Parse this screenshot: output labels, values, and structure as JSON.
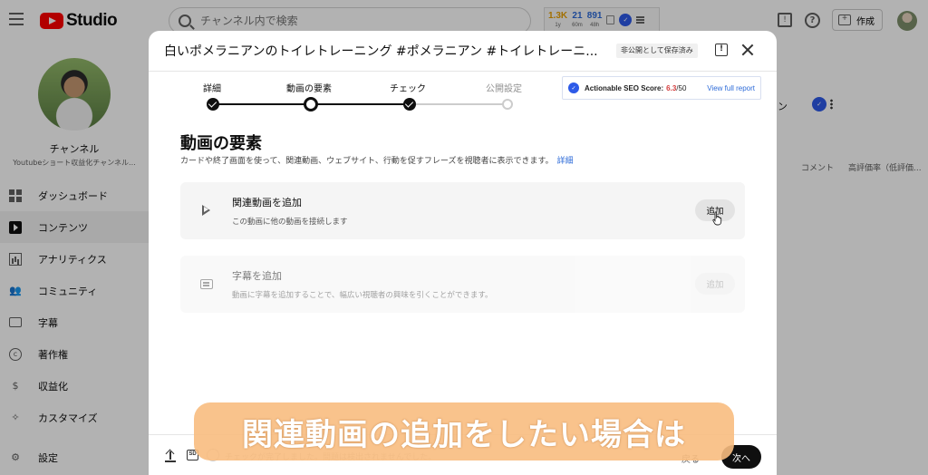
{
  "app": {
    "logo_text": "Studio"
  },
  "search": {
    "placeholder": "チャンネル内で検索"
  },
  "stats_bar": {
    "items": [
      {
        "value": "1.3K",
        "sub": "1y"
      },
      {
        "value": "21",
        "sub": "60m"
      },
      {
        "value": "891",
        "sub": "48h"
      }
    ]
  },
  "header": {
    "create_label": "作成"
  },
  "sidebar": {
    "channel_label": "チャンネル",
    "channel_name": "Youtubeショート収益化チャンネル...",
    "items": [
      {
        "label": "ダッシュボード",
        "icon": "dashboard-icon"
      },
      {
        "label": "コンテンツ",
        "icon": "content-icon",
        "active": true
      },
      {
        "label": "アナリティクス",
        "icon": "analytics-icon"
      },
      {
        "label": "コミュニティ",
        "icon": "community-icon"
      },
      {
        "label": "字幕",
        "icon": "subtitles-icon"
      },
      {
        "label": "著作権",
        "icon": "copyright-icon"
      },
      {
        "label": "収益化",
        "icon": "monetization-icon"
      },
      {
        "label": "カスタマイズ",
        "icon": "customize-icon"
      }
    ],
    "settings_label": "設定"
  },
  "background": {
    "tab_fragment": "ン",
    "col_comments": "コメント",
    "col_rating": "高評価率（低評価..."
  },
  "dialog": {
    "title": "白いポメラニアンのトイレトレーニング #ポメラニアン #トイレトレーニ...",
    "saved_badge": "非公開として保存済み",
    "steps": [
      {
        "label": "詳細",
        "state": "done"
      },
      {
        "label": "動画の要素",
        "state": "current"
      },
      {
        "label": "チェック",
        "state": "done"
      },
      {
        "label": "公開設定",
        "state": "pending"
      }
    ],
    "seo": {
      "label": "Actionable SEO Score:",
      "score": "6.3",
      "max": "/50",
      "link": "View full report"
    },
    "section_title": "動画の要素",
    "section_desc": "カードや終了画面を使って、関連動画、ウェブサイト、行動を促すフレーズを視聴者に表示できます。",
    "section_link": "詳細",
    "cards": [
      {
        "title": "関連動画を追加",
        "desc": "この動画に他の動画を接続します",
        "button": "追加",
        "enabled": true
      },
      {
        "title": "字幕を追加",
        "desc": "動画に字幕を追加することで、幅広い視聴者の興味を引くことができます。",
        "button": "追加",
        "enabled": false
      }
    ],
    "footer": {
      "sd_badge": "SD",
      "status": "チェックが完了しました。問題は検出されませんでした。",
      "back_label": "戻る",
      "next_label": "次へ"
    }
  },
  "caption": {
    "text": "関連動画の追加をしたい場合は"
  },
  "colors": {
    "accent_blue": "#2d6bd8",
    "brand_red": "#ff0000",
    "seo_score_red": "#d43c3c",
    "caption_bg": "#f8bc80"
  }
}
